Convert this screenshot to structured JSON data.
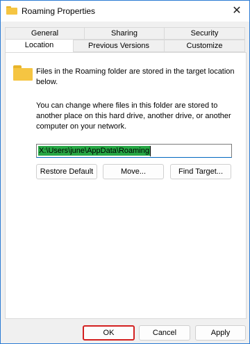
{
  "window": {
    "title": "Roaming Properties"
  },
  "tabs": {
    "row1": [
      "General",
      "Sharing",
      "Security"
    ],
    "row2": [
      "Location",
      "Previous Versions",
      "Customize"
    ],
    "active": "Location"
  },
  "location": {
    "description": "Files in the Roaming folder are stored in the target location below.",
    "instructions": "You can change where files in this folder are stored to another place on this hard drive, another drive, or another computer on your network.",
    "path_value": "X:\\Users\\june\\AppData\\Roaming",
    "restore_default_label": "Restore Default",
    "move_label": "Move...",
    "find_target_label": "Find Target..."
  },
  "footer": {
    "ok_label": "OK",
    "cancel_label": "Cancel",
    "apply_label": "Apply"
  },
  "icons": {
    "title_icon": "folder-icon",
    "close_icon": "close-icon",
    "location_icon": "folder-icon"
  },
  "colors": {
    "window_border": "#2b7bd4",
    "selection": "#27a745",
    "folder": "#f5c542",
    "focus_outline": "#d32020"
  }
}
